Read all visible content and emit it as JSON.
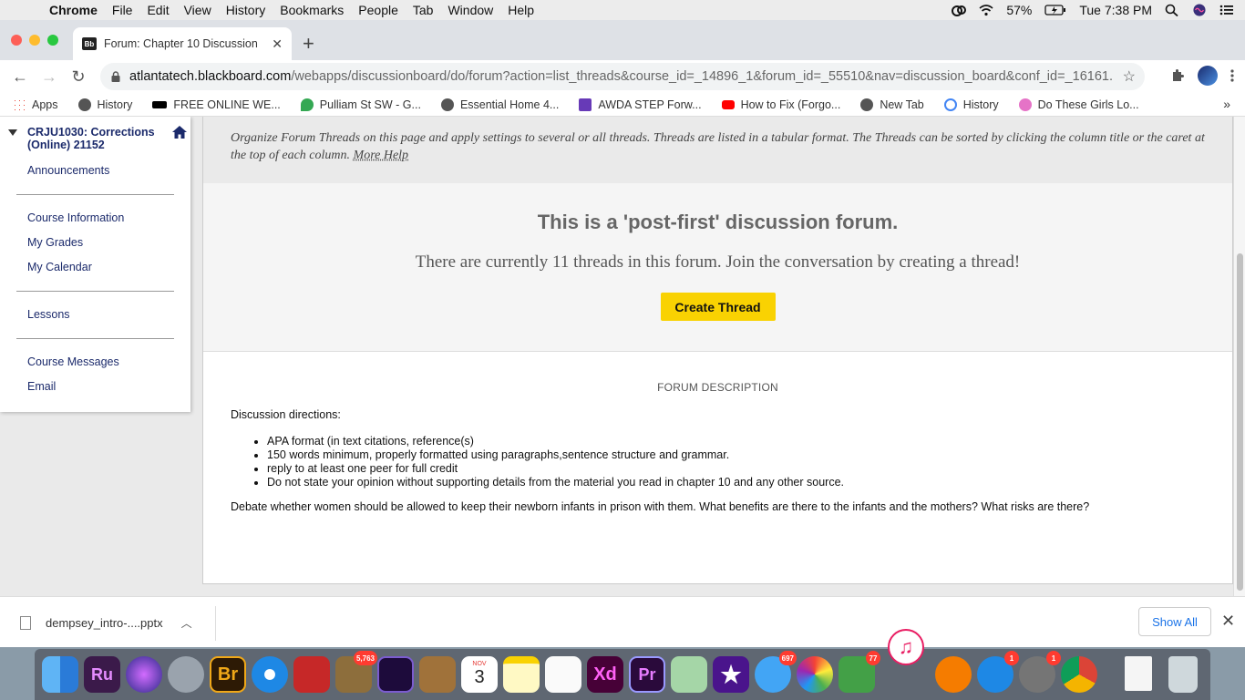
{
  "menubar": {
    "items": [
      "Chrome",
      "File",
      "Edit",
      "View",
      "History",
      "Bookmarks",
      "People",
      "Tab",
      "Window",
      "Help"
    ],
    "battery": "57%",
    "clock": "Tue 7:38 PM"
  },
  "tab": {
    "title": "Forum: Chapter 10 Discussion",
    "favicon_text": "Bb"
  },
  "address": {
    "host": "atlantatech.blackboard.com",
    "path": "/webapps/discussionboard/do/forum?action=list_threads&course_id=_14896_1&forum_id=_55510&nav=discussion_board&conf_id=_16161..."
  },
  "bookmarks": [
    {
      "label": "Apps",
      "icon": "apps-grid-icon",
      "color": "#e94235"
    },
    {
      "label": "History",
      "icon": "globe-icon",
      "color": "#555555"
    },
    {
      "label": "FREE ONLINE WE...",
      "icon": "wix-icon",
      "color": "#000000"
    },
    {
      "label": "Pulliam St SW - G...",
      "icon": "maps-pin-icon",
      "color": "#34a853"
    },
    {
      "label": "Essential Home 4...",
      "icon": "globe-icon",
      "color": "#555555"
    },
    {
      "label": "AWDA STEP Forw...",
      "icon": "forms-icon",
      "color": "#673ab7"
    },
    {
      "label": "How to Fix (Forgo...",
      "icon": "youtube-icon",
      "color": "#ff0000"
    },
    {
      "label": "New Tab",
      "icon": "globe-icon",
      "color": "#555555"
    },
    {
      "label": "History",
      "icon": "history-icon",
      "color": "#4285f4"
    },
    {
      "label": "Do These Girls Lo...",
      "icon": "butterfly-icon",
      "color": "#e573c7"
    }
  ],
  "course_menu": {
    "title": "CRJU1030: Corrections (Online) 21152",
    "links": [
      "Announcements",
      "Course Information",
      "My Grades",
      "My Calendar",
      "Lessons",
      "Course Messages",
      "Email"
    ]
  },
  "help": {
    "text": "Organize Forum Threads on this page and apply settings to several or all threads. Threads are listed in a tabular format. The Threads can be sorted by clicking the column title or the caret at the top of each column.",
    "more": "More Help"
  },
  "post_first": {
    "heading": "This is a 'post-first' discussion forum.",
    "subtext": "There are currently 11 threads in this forum. Join the conversation by creating a thread!",
    "button": "Create Thread"
  },
  "forum_description": {
    "heading": "FORUM DESCRIPTION",
    "intro": "Discussion directions:",
    "bullets": [
      "APA format (in text citations, reference(s)",
      "150 words minimum, properly formatted using paragraphs,sentence structure and grammar.",
      "reply to at least one peer for full credit",
      "Do not state your opinion without supporting details from the material you read in chapter 10 and any other source."
    ],
    "prompt": "Debate whether women should be allowed to keep their newborn infants in prison with them. What benefits are there to the infants and the mothers? What risks are there?"
  },
  "downloads": {
    "file": "dempsey_intro-....pptx",
    "show_all": "Show All"
  },
  "dock": {
    "calendar_month": "NOV",
    "calendar_day": "3",
    "badges": {
      "mail": "5,763",
      "messages": "697",
      "facetime": "77",
      "appstore": "1",
      "prefs": "1"
    }
  }
}
